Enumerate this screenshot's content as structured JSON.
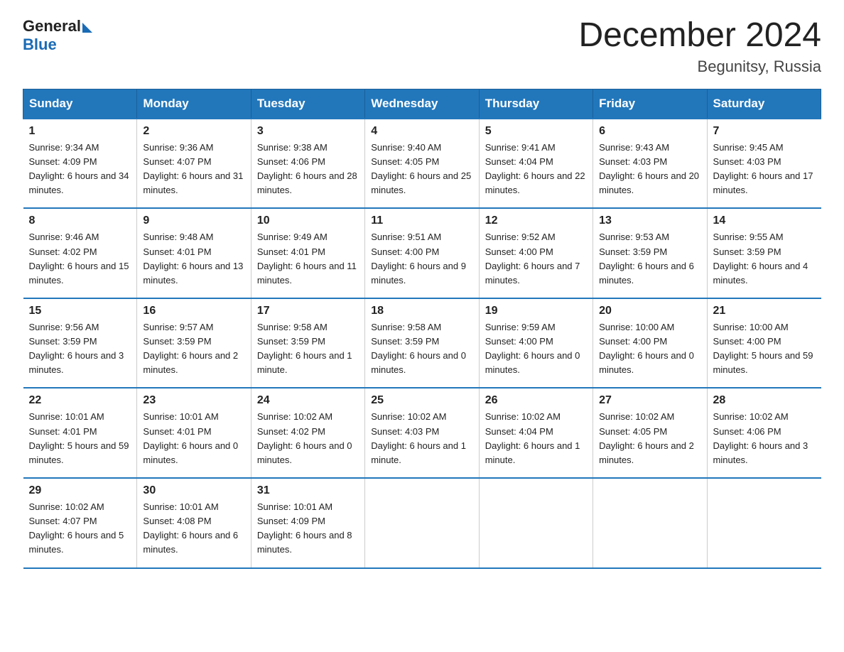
{
  "logo": {
    "general": "General",
    "triangle": "▶",
    "blue": "Blue"
  },
  "title": "December 2024",
  "location": "Begunitsy, Russia",
  "days_of_week": [
    "Sunday",
    "Monday",
    "Tuesday",
    "Wednesday",
    "Thursday",
    "Friday",
    "Saturday"
  ],
  "weeks": [
    [
      {
        "day": "1",
        "sunrise": "Sunrise: 9:34 AM",
        "sunset": "Sunset: 4:09 PM",
        "daylight": "Daylight: 6 hours and 34 minutes."
      },
      {
        "day": "2",
        "sunrise": "Sunrise: 9:36 AM",
        "sunset": "Sunset: 4:07 PM",
        "daylight": "Daylight: 6 hours and 31 minutes."
      },
      {
        "day": "3",
        "sunrise": "Sunrise: 9:38 AM",
        "sunset": "Sunset: 4:06 PM",
        "daylight": "Daylight: 6 hours and 28 minutes."
      },
      {
        "day": "4",
        "sunrise": "Sunrise: 9:40 AM",
        "sunset": "Sunset: 4:05 PM",
        "daylight": "Daylight: 6 hours and 25 minutes."
      },
      {
        "day": "5",
        "sunrise": "Sunrise: 9:41 AM",
        "sunset": "Sunset: 4:04 PM",
        "daylight": "Daylight: 6 hours and 22 minutes."
      },
      {
        "day": "6",
        "sunrise": "Sunrise: 9:43 AM",
        "sunset": "Sunset: 4:03 PM",
        "daylight": "Daylight: 6 hours and 20 minutes."
      },
      {
        "day": "7",
        "sunrise": "Sunrise: 9:45 AM",
        "sunset": "Sunset: 4:03 PM",
        "daylight": "Daylight: 6 hours and 17 minutes."
      }
    ],
    [
      {
        "day": "8",
        "sunrise": "Sunrise: 9:46 AM",
        "sunset": "Sunset: 4:02 PM",
        "daylight": "Daylight: 6 hours and 15 minutes."
      },
      {
        "day": "9",
        "sunrise": "Sunrise: 9:48 AM",
        "sunset": "Sunset: 4:01 PM",
        "daylight": "Daylight: 6 hours and 13 minutes."
      },
      {
        "day": "10",
        "sunrise": "Sunrise: 9:49 AM",
        "sunset": "Sunset: 4:01 PM",
        "daylight": "Daylight: 6 hours and 11 minutes."
      },
      {
        "day": "11",
        "sunrise": "Sunrise: 9:51 AM",
        "sunset": "Sunset: 4:00 PM",
        "daylight": "Daylight: 6 hours and 9 minutes."
      },
      {
        "day": "12",
        "sunrise": "Sunrise: 9:52 AM",
        "sunset": "Sunset: 4:00 PM",
        "daylight": "Daylight: 6 hours and 7 minutes."
      },
      {
        "day": "13",
        "sunrise": "Sunrise: 9:53 AM",
        "sunset": "Sunset: 3:59 PM",
        "daylight": "Daylight: 6 hours and 6 minutes."
      },
      {
        "day": "14",
        "sunrise": "Sunrise: 9:55 AM",
        "sunset": "Sunset: 3:59 PM",
        "daylight": "Daylight: 6 hours and 4 minutes."
      }
    ],
    [
      {
        "day": "15",
        "sunrise": "Sunrise: 9:56 AM",
        "sunset": "Sunset: 3:59 PM",
        "daylight": "Daylight: 6 hours and 3 minutes."
      },
      {
        "day": "16",
        "sunrise": "Sunrise: 9:57 AM",
        "sunset": "Sunset: 3:59 PM",
        "daylight": "Daylight: 6 hours and 2 minutes."
      },
      {
        "day": "17",
        "sunrise": "Sunrise: 9:58 AM",
        "sunset": "Sunset: 3:59 PM",
        "daylight": "Daylight: 6 hours and 1 minute."
      },
      {
        "day": "18",
        "sunrise": "Sunrise: 9:58 AM",
        "sunset": "Sunset: 3:59 PM",
        "daylight": "Daylight: 6 hours and 0 minutes."
      },
      {
        "day": "19",
        "sunrise": "Sunrise: 9:59 AM",
        "sunset": "Sunset: 4:00 PM",
        "daylight": "Daylight: 6 hours and 0 minutes."
      },
      {
        "day": "20",
        "sunrise": "Sunrise: 10:00 AM",
        "sunset": "Sunset: 4:00 PM",
        "daylight": "Daylight: 6 hours and 0 minutes."
      },
      {
        "day": "21",
        "sunrise": "Sunrise: 10:00 AM",
        "sunset": "Sunset: 4:00 PM",
        "daylight": "Daylight: 5 hours and 59 minutes."
      }
    ],
    [
      {
        "day": "22",
        "sunrise": "Sunrise: 10:01 AM",
        "sunset": "Sunset: 4:01 PM",
        "daylight": "Daylight: 5 hours and 59 minutes."
      },
      {
        "day": "23",
        "sunrise": "Sunrise: 10:01 AM",
        "sunset": "Sunset: 4:01 PM",
        "daylight": "Daylight: 6 hours and 0 minutes."
      },
      {
        "day": "24",
        "sunrise": "Sunrise: 10:02 AM",
        "sunset": "Sunset: 4:02 PM",
        "daylight": "Daylight: 6 hours and 0 minutes."
      },
      {
        "day": "25",
        "sunrise": "Sunrise: 10:02 AM",
        "sunset": "Sunset: 4:03 PM",
        "daylight": "Daylight: 6 hours and 1 minute."
      },
      {
        "day": "26",
        "sunrise": "Sunrise: 10:02 AM",
        "sunset": "Sunset: 4:04 PM",
        "daylight": "Daylight: 6 hours and 1 minute."
      },
      {
        "day": "27",
        "sunrise": "Sunrise: 10:02 AM",
        "sunset": "Sunset: 4:05 PM",
        "daylight": "Daylight: 6 hours and 2 minutes."
      },
      {
        "day": "28",
        "sunrise": "Sunrise: 10:02 AM",
        "sunset": "Sunset: 4:06 PM",
        "daylight": "Daylight: 6 hours and 3 minutes."
      }
    ],
    [
      {
        "day": "29",
        "sunrise": "Sunrise: 10:02 AM",
        "sunset": "Sunset: 4:07 PM",
        "daylight": "Daylight: 6 hours and 5 minutes."
      },
      {
        "day": "30",
        "sunrise": "Sunrise: 10:01 AM",
        "sunset": "Sunset: 4:08 PM",
        "daylight": "Daylight: 6 hours and 6 minutes."
      },
      {
        "day": "31",
        "sunrise": "Sunrise: 10:01 AM",
        "sunset": "Sunset: 4:09 PM",
        "daylight": "Daylight: 6 hours and 8 minutes."
      },
      null,
      null,
      null,
      null
    ]
  ]
}
